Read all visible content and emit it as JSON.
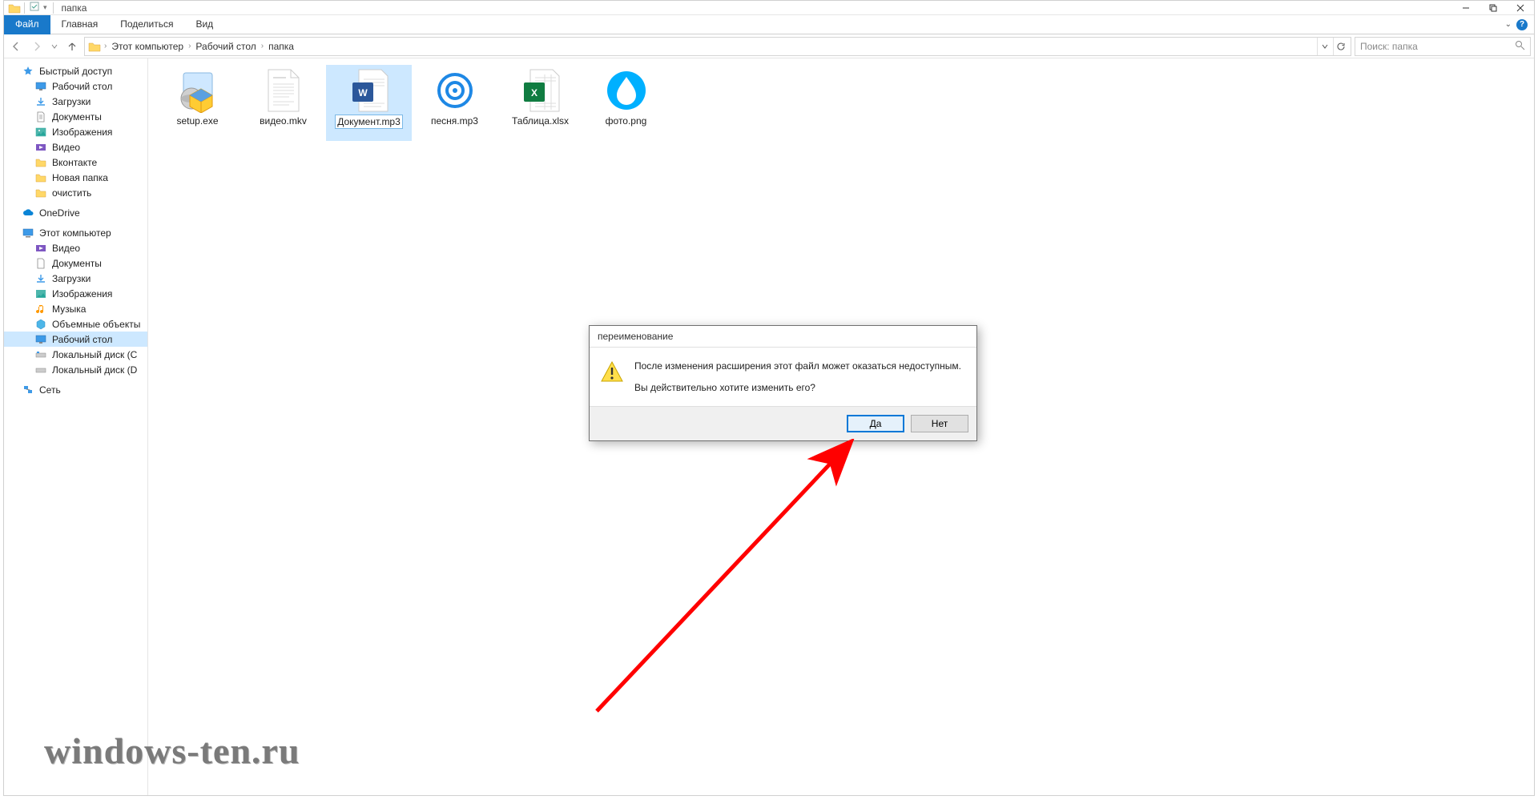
{
  "titlebar": {
    "title": "папка"
  },
  "ribbon": {
    "file": "Файл",
    "tabs": [
      "Главная",
      "Поделиться",
      "Вид"
    ]
  },
  "nav": {
    "back": "←",
    "forward": "→",
    "up": "↑",
    "crumbs": [
      "Этот компьютер",
      "Рабочий стол",
      "папка"
    ],
    "search_placeholder": "Поиск: папка"
  },
  "sidebar": {
    "quick": {
      "label": "Быстрый доступ",
      "items": [
        "Рабочий стол",
        "Загрузки",
        "Документы",
        "Изображения",
        "Видео",
        "Вконтакте",
        "Новая папка",
        "очистить"
      ]
    },
    "onedrive": "OneDrive",
    "thispc": {
      "label": "Этот компьютер",
      "items": [
        "Видео",
        "Документы",
        "Загрузки",
        "Изображения",
        "Музыка",
        "Объемные объекты",
        "Рабочий стол",
        "Локальный диск (C",
        "Локальный диск (D"
      ]
    },
    "network": "Сеть"
  },
  "files": [
    {
      "name": "setup.exe",
      "type": "installer"
    },
    {
      "name": "видео.mkv",
      "type": "text"
    },
    {
      "name": "Документ.mp3",
      "type": "word",
      "selected": true
    },
    {
      "name": "песня.mp3",
      "type": "disc"
    },
    {
      "name": "Таблица.xlsx",
      "type": "excel"
    },
    {
      "name": "фото.png",
      "type": "drop"
    }
  ],
  "dialog": {
    "title": "переименование",
    "line1": "После изменения расширения этот файл может оказаться недоступным.",
    "line2": "Вы действительно хотите изменить его?",
    "yes": "Да",
    "no": "Нет"
  },
  "watermark": "windows-ten.ru"
}
